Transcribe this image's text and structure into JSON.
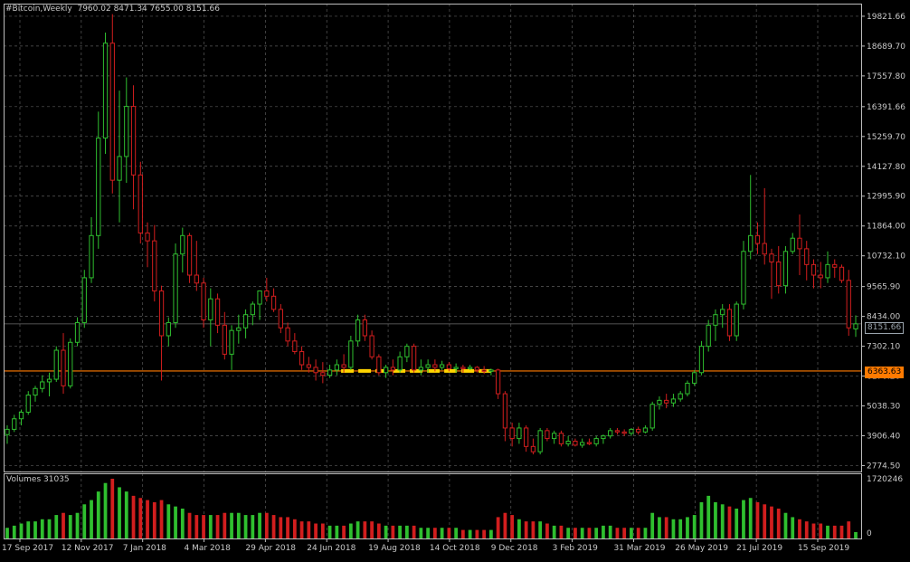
{
  "window": {
    "symbol": "#Bitcoin,Weekly",
    "ohlc": "7960.02 8471.34 7655.00 8151.66"
  },
  "volume_panel": {
    "label": "Volumes 31035",
    "axis_labels": [
      "1720246",
      "0"
    ]
  },
  "price_tags": {
    "last_price": "8151.66",
    "horizontal_line": "6363.63"
  },
  "colors": {
    "background": "#000000",
    "grid": "#5a5a5a",
    "bull": "#2fbf2f",
    "bear": "#d21e1e",
    "hline": "#ff7a00",
    "highlight": "#ffd400"
  },
  "chart_data": {
    "type": "candlestick",
    "title": "#Bitcoin,Weekly",
    "price_axis_ticks": [
      19821.66,
      18689.7,
      17557.8,
      16391.66,
      15259.7,
      14127.8,
      12995.9,
      11864.0,
      10732.1,
      9565.9,
      8434.0,
      7302.1,
      6170.2,
      5038.3,
      3906.4,
      2774.5
    ],
    "price_axis_labels": [
      "19821.66",
      "18689.70",
      "17557.80",
      "16391.66",
      "15259.70",
      "14127.80",
      "12995.90",
      "11864.00",
      "10732.10",
      "9565.90",
      "8434.00",
      "7302.10",
      "6170.20",
      "5038.30",
      "3906.40",
      "2774.50"
    ],
    "time_axis_labels": [
      "17 Sep 2017",
      "12 Nov 2017",
      "7 Jan 2018",
      "4 Mar 2018",
      "29 Apr 2018",
      "24 Jun 2018",
      "19 Aug 2018",
      "14 Oct 2018",
      "9 Dec 2018",
      "3 Feb 2019",
      "31 Mar 2019",
      "26 May 2019",
      "21 Jul 2019",
      "15 Sep 2019"
    ],
    "ylim": [
      2550,
      20300
    ],
    "horizontal_line": 6363.63,
    "last_price": 8151.66,
    "candles": [
      [
        3950,
        4300,
        3600,
        4150,
        25
      ],
      [
        4150,
        4700,
        4050,
        4550,
        30
      ],
      [
        4550,
        4900,
        4300,
        4800,
        35
      ],
      [
        4800,
        5600,
        4700,
        5450,
        40
      ],
      [
        5450,
        5800,
        5200,
        5700,
        40
      ],
      [
        5700,
        6200,
        5550,
        5950,
        45
      ],
      [
        5950,
        6300,
        5400,
        6050,
        45
      ],
      [
        6050,
        7300,
        5950,
        7150,
        55
      ],
      [
        7150,
        7800,
        5500,
        5800,
        60
      ],
      [
        5800,
        7600,
        5700,
        7450,
        55
      ],
      [
        7450,
        8400,
        7300,
        8200,
        60
      ],
      [
        8200,
        10200,
        8000,
        9900,
        80
      ],
      [
        9900,
        12200,
        9700,
        11500,
        90
      ],
      [
        11500,
        16200,
        11000,
        15200,
        110
      ],
      [
        15200,
        19200,
        14600,
        18800,
        130
      ],
      [
        18800,
        19900,
        13100,
        13600,
        140
      ],
      [
        13600,
        17000,
        12000,
        14500,
        120
      ],
      [
        14500,
        17500,
        13500,
        16400,
        110
      ],
      [
        16400,
        17200,
        12500,
        13800,
        100
      ],
      [
        13800,
        14300,
        11200,
        11600,
        95
      ],
      [
        11600,
        12000,
        10300,
        11300,
        90
      ],
      [
        11300,
        11900,
        9000,
        9400,
        85
      ],
      [
        9400,
        9600,
        6000,
        7700,
        90
      ],
      [
        7700,
        8400,
        7300,
        8200,
        80
      ],
      [
        8200,
        11200,
        8000,
        10800,
        75
      ],
      [
        10800,
        11800,
        10100,
        11500,
        70
      ],
      [
        11500,
        11600,
        9700,
        10000,
        60
      ],
      [
        10000,
        11300,
        9400,
        9700,
        55
      ],
      [
        9700,
        9900,
        8000,
        8300,
        55
      ],
      [
        8300,
        9500,
        7300,
        9100,
        55
      ],
      [
        9100,
        9300,
        7800,
        8100,
        55
      ],
      [
        8100,
        8600,
        6800,
        7000,
        60
      ],
      [
        7000,
        8100,
        6400,
        7900,
        60
      ],
      [
        7900,
        8500,
        7400,
        8000,
        60
      ],
      [
        8000,
        8700,
        7600,
        8500,
        55
      ],
      [
        8500,
        9000,
        8100,
        8900,
        55
      ],
      [
        8900,
        9300,
        8300,
        9400,
        60
      ],
      [
        9400,
        9900,
        9000,
        9200,
        60
      ],
      [
        9200,
        9500,
        8600,
        8700,
        55
      ],
      [
        8700,
        8900,
        7800,
        8000,
        50
      ],
      [
        8000,
        8200,
        7300,
        7500,
        50
      ],
      [
        7500,
        7800,
        7000,
        7100,
        45
      ],
      [
        7100,
        7300,
        6400,
        6600,
        40
      ],
      [
        6600,
        6900,
        6300,
        6500,
        40
      ],
      [
        6500,
        6800,
        6000,
        6300,
        35
      ],
      [
        6300,
        6700,
        5900,
        6200,
        35
      ],
      [
        6200,
        6600,
        6100,
        6400,
        30
      ],
      [
        6400,
        6800,
        6200,
        6600,
        30
      ],
      [
        6600,
        7000,
        6300,
        6500,
        30
      ],
      [
        6500,
        7700,
        6400,
        7500,
        35
      ],
      [
        7500,
        8500,
        7300,
        8300,
        40
      ],
      [
        8300,
        8500,
        7500,
        7700,
        40
      ],
      [
        7700,
        7900,
        6800,
        6900,
        40
      ],
      [
        6900,
        7000,
        6200,
        6300,
        35
      ],
      [
        6300,
        6600,
        6100,
        6500,
        30
      ],
      [
        6500,
        6800,
        6200,
        6400,
        30
      ],
      [
        6400,
        7100,
        6300,
        6900,
        30
      ],
      [
        6900,
        7400,
        6700,
        7300,
        30
      ],
      [
        7300,
        7400,
        6300,
        6400,
        30
      ],
      [
        6400,
        6800,
        6200,
        6500,
        25
      ],
      [
        6500,
        6800,
        6300,
        6600,
        25
      ],
      [
        6600,
        6800,
        6350,
        6500,
        25
      ],
      [
        6500,
        6750,
        6400,
        6600,
        25
      ],
      [
        6600,
        6700,
        6350,
        6450,
        25
      ],
      [
        6450,
        6650,
        6300,
        6500,
        25
      ],
      [
        6500,
        6600,
        6300,
        6450,
        20
      ],
      [
        6450,
        6600,
        6400,
        6500,
        20
      ],
      [
        6500,
        6550,
        6300,
        6400,
        20
      ],
      [
        6400,
        6550,
        6250,
        6350,
        20
      ],
      [
        6350,
        6450,
        6200,
        6400,
        20
      ],
      [
        6400,
        6450,
        5300,
        5500,
        50
      ],
      [
        5500,
        5600,
        3700,
        4200,
        60
      ],
      [
        4200,
        4400,
        3500,
        3800,
        55
      ],
      [
        3800,
        4400,
        3600,
        4200,
        45
      ],
      [
        4200,
        4300,
        3300,
        3500,
        40
      ],
      [
        3500,
        3800,
        3200,
        3300,
        40
      ],
      [
        3300,
        4200,
        3200,
        4100,
        40
      ],
      [
        4100,
        4200,
        3700,
        3800,
        35
      ],
      [
        3800,
        4100,
        3600,
        4000,
        30
      ],
      [
        4000,
        4100,
        3500,
        3600,
        30
      ],
      [
        3600,
        3900,
        3500,
        3700,
        25
      ],
      [
        3700,
        3800,
        3500,
        3550,
        25
      ],
      [
        3550,
        3800,
        3450,
        3650,
        25
      ],
      [
        3650,
        3800,
        3550,
        3600,
        25
      ],
      [
        3600,
        3900,
        3500,
        3800,
        25
      ],
      [
        3800,
        3950,
        3600,
        3900,
        30
      ],
      [
        3900,
        4200,
        3800,
        4100,
        30
      ],
      [
        4100,
        4200,
        3950,
        4050,
        25
      ],
      [
        4050,
        4150,
        3900,
        4000,
        25
      ],
      [
        4000,
        4200,
        3900,
        4150,
        25
      ],
      [
        4150,
        4250,
        3950,
        4050,
        25
      ],
      [
        4050,
        4300,
        4000,
        4200,
        25
      ],
      [
        4200,
        5200,
        4100,
        5100,
        60
      ],
      [
        5100,
        5400,
        4900,
        5250,
        50
      ],
      [
        5250,
        5500,
        4950,
        5150,
        50
      ],
      [
        5150,
        5500,
        5000,
        5300,
        45
      ],
      [
        5300,
        5600,
        5200,
        5500,
        45
      ],
      [
        5500,
        6000,
        5400,
        5900,
        50
      ],
      [
        5900,
        6400,
        5800,
        6300,
        55
      ],
      [
        6300,
        7500,
        6200,
        7300,
        85
      ],
      [
        7300,
        8300,
        7100,
        8100,
        100
      ],
      [
        8100,
        8700,
        7500,
        8500,
        85
      ],
      [
        8500,
        8900,
        8000,
        8700,
        80
      ],
      [
        8700,
        8900,
        7500,
        7700,
        75
      ],
      [
        7700,
        9000,
        7500,
        8900,
        70
      ],
      [
        8900,
        11300,
        8700,
        10900,
        90
      ],
      [
        10900,
        13800,
        10600,
        11500,
        95
      ],
      [
        11500,
        12000,
        10800,
        11200,
        85
      ],
      [
        11200,
        13300,
        10400,
        10800,
        80
      ],
      [
        10800,
        11000,
        9100,
        10500,
        75
      ],
      [
        10500,
        11100,
        9300,
        9600,
        70
      ],
      [
        9600,
        11100,
        9300,
        10900,
        60
      ],
      [
        10900,
        11600,
        10800,
        11400,
        50
      ],
      [
        11400,
        12300,
        10000,
        11000,
        45
      ],
      [
        11000,
        11300,
        9800,
        10400,
        40
      ],
      [
        10400,
        10600,
        9500,
        10000,
        35
      ],
      [
        10000,
        10500,
        9500,
        9900,
        35
      ],
      [
        9900,
        10900,
        9700,
        10400,
        30
      ],
      [
        10400,
        10600,
        9900,
        10300,
        30
      ],
      [
        10300,
        10400,
        9700,
        9800,
        30
      ],
      [
        9800,
        10200,
        7700,
        8000,
        40
      ],
      [
        7960,
        8471,
        7655,
        8152,
        15
      ]
    ]
  }
}
